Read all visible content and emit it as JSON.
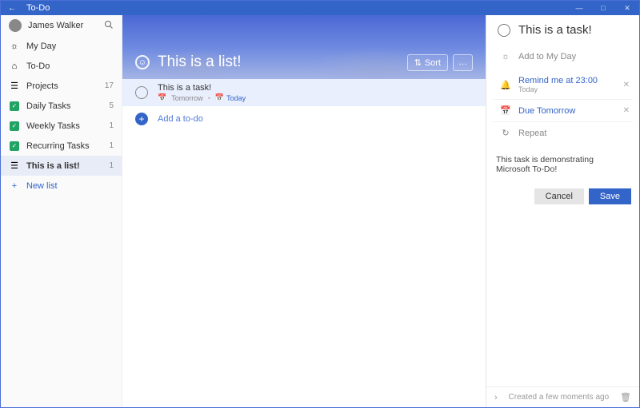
{
  "titlebar": {
    "title": "To-Do"
  },
  "user": {
    "name": "James Walker"
  },
  "nav": {
    "myday": "My Day",
    "todo": "To-Do",
    "newlist": "New list",
    "lists": [
      {
        "label": "Projects",
        "count": "17",
        "kind": "menu"
      },
      {
        "label": "Daily Tasks",
        "count": "5",
        "kind": "check"
      },
      {
        "label": "Weekly Tasks",
        "count": "1",
        "kind": "check"
      },
      {
        "label": "Recurring Tasks",
        "count": "1",
        "kind": "check"
      },
      {
        "label": "This is a list!",
        "count": "1",
        "kind": "menu",
        "selected": true
      }
    ]
  },
  "hero": {
    "title": "This is a list!",
    "sort": "Sort"
  },
  "tasks": [
    {
      "title": "This is a task!",
      "meta1": "Tomorrow",
      "meta2": "Today"
    }
  ],
  "add": {
    "placeholder": "Add a to-do"
  },
  "detail": {
    "title": "This is a task!",
    "addmyday": "Add to My Day",
    "remind": {
      "line1": "Remind me at 23:00",
      "line2": "Today"
    },
    "due": "Due Tomorrow",
    "repeat": "Repeat",
    "note": "This task is demonstrating Microsoft To-Do!",
    "cancel": "Cancel",
    "save": "Save",
    "created": "Created a few moments ago"
  }
}
